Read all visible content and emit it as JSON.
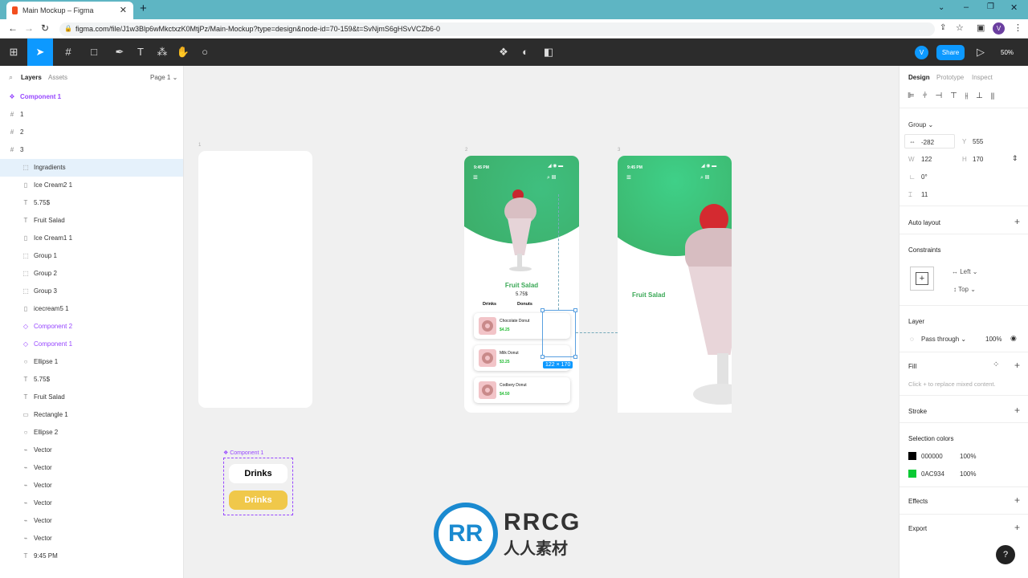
{
  "browser": {
    "tab_title": "Main Mockup – Figma",
    "url": "figma.com/file/J1w3Blp6wMkctxzK0MtjPz/Main-Mockup?type=design&node-id=70-159&t=SvNjmS6gHSvVCZb6-0",
    "profile": "V"
  },
  "toolbar": {
    "avatar": "V",
    "share": "Share",
    "zoom": "50%"
  },
  "left_panel": {
    "tab_layers": "Layers",
    "tab_assets": "Assets",
    "page": "Page 1",
    "layers": [
      {
        "name": "Component 1",
        "icon": "component-icon",
        "purple": true,
        "indent": 0
      },
      {
        "name": "1",
        "icon": "frame-icon",
        "indent": 0
      },
      {
        "name": "2",
        "icon": "frame-icon",
        "indent": 0
      },
      {
        "name": "3",
        "icon": "frame-icon",
        "indent": 0
      },
      {
        "name": "Ingradients",
        "icon": "group-icon",
        "indent": 1,
        "selected": true
      },
      {
        "name": "Ice Cream2 1",
        "icon": "image-icon",
        "indent": 1
      },
      {
        "name": "5.75$",
        "icon": "text-icon",
        "indent": 1
      },
      {
        "name": "Fruit Salad",
        "icon": "text-icon",
        "indent": 1
      },
      {
        "name": "Ice Cream1 1",
        "icon": "image-icon",
        "indent": 1
      },
      {
        "name": "Group 1",
        "icon": "group-icon",
        "indent": 1
      },
      {
        "name": "Group 2",
        "icon": "group-icon",
        "indent": 1
      },
      {
        "name": "Group 3",
        "icon": "group-icon",
        "indent": 1
      },
      {
        "name": "icecream5 1",
        "icon": "image-icon",
        "indent": 1
      },
      {
        "name": "Component 2",
        "icon": "instance-icon",
        "purple": true,
        "indent": 1
      },
      {
        "name": "Component 1",
        "icon": "instance-icon",
        "purple": true,
        "indent": 1
      },
      {
        "name": "Ellipse 1",
        "icon": "ellipse-icon",
        "indent": 1
      },
      {
        "name": "5.75$",
        "icon": "text-icon",
        "indent": 1
      },
      {
        "name": "Fruit Salad",
        "icon": "text-icon",
        "indent": 1
      },
      {
        "name": "Rectangle 1",
        "icon": "rectangle-icon",
        "indent": 1
      },
      {
        "name": "Ellipse 2",
        "icon": "ellipse-icon",
        "indent": 1
      },
      {
        "name": "Vector",
        "icon": "vector-icon",
        "indent": 1
      },
      {
        "name": "Vector",
        "icon": "vector-icon",
        "indent": 1
      },
      {
        "name": "Vector",
        "icon": "vector-icon",
        "indent": 1
      },
      {
        "name": "Vector",
        "icon": "vector-icon",
        "indent": 1
      },
      {
        "name": "Vector",
        "icon": "vector-icon",
        "indent": 1
      },
      {
        "name": "Vector",
        "icon": "vector-icon",
        "indent": 1
      },
      {
        "name": "9:45 PM",
        "icon": "text-icon",
        "indent": 1
      }
    ]
  },
  "canvas": {
    "frame1_label": "1",
    "frame2_label": "2",
    "frame3_label": "3",
    "phone2": {
      "time": "9:45 PM",
      "title": "Fruit Salad",
      "price": "5.75$",
      "tab1": "Drinks",
      "tab2": "Donuts",
      "items": [
        {
          "name": "Chocolate Donut",
          "price": "$4.25"
        },
        {
          "name": "Milk Donut",
          "price": "$3.25"
        },
        {
          "name": "Codbery Donut",
          "price": "$4.50"
        }
      ]
    },
    "selection_size": "122 × 170",
    "phone3": {
      "time": "9:45 PM",
      "title": "Fruit Salad"
    },
    "component": {
      "label": "Component 1",
      "btn1": "Drinks",
      "btn2": "Drinks"
    },
    "watermark": {
      "text": "RRCG",
      "sub": "人人素材"
    }
  },
  "right_panel": {
    "tab_design": "Design",
    "tab_prototype": "Prototype",
    "tab_inspect": "Inspect",
    "group_label": "Group",
    "x": "-282",
    "y_label": "Y",
    "y": "555",
    "w_label": "W",
    "w": "122",
    "h_label": "H",
    "h": "170",
    "rotation": "0°",
    "spacing": "11",
    "auto_layout": "Auto layout",
    "constraints": "Constraints",
    "constraint_h": "Left",
    "constraint_v": "Top",
    "layer": "Layer",
    "blend": "Pass through",
    "opacity": "100%",
    "fill": "Fill",
    "fill_hint": "Click + to replace mixed content.",
    "stroke": "Stroke",
    "selection_colors": "Selection colors",
    "colors": [
      {
        "hex": "000000",
        "opacity": "100%",
        "swatch": "#000000"
      },
      {
        "hex": "0AC934",
        "opacity": "100%",
        "swatch": "#0AC934"
      }
    ],
    "effects": "Effects",
    "export": "Export"
  },
  "colors": {
    "accent": "#0d99ff",
    "figma_purple": "#9747ff",
    "green": "#3aa856"
  }
}
